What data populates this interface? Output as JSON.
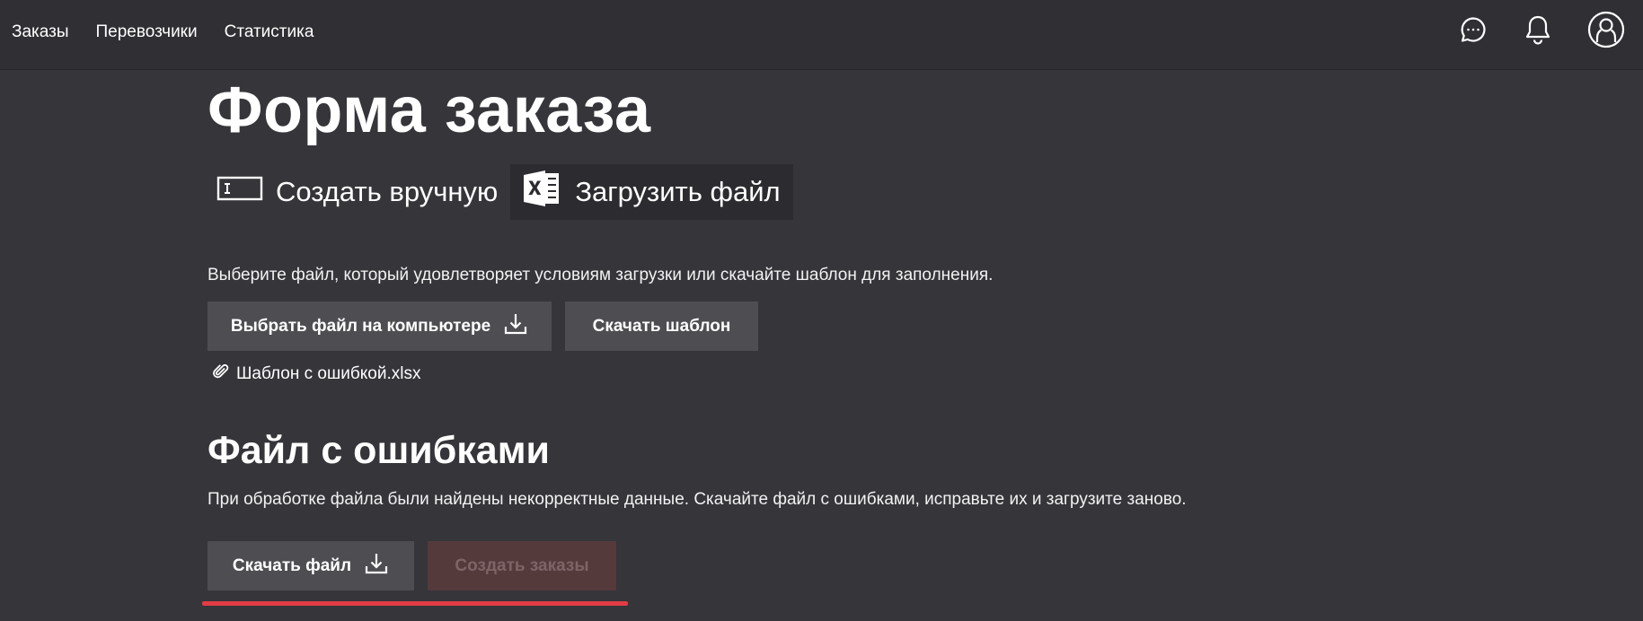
{
  "nav": {
    "items": [
      "Заказы",
      "Перевозчики",
      "Статистика"
    ]
  },
  "header_icons": [
    "chat-icon",
    "bell-icon",
    "user-avatar-icon"
  ],
  "page": {
    "title": "Форма заказа"
  },
  "mode_tabs": {
    "manual_label": "Создать вручную",
    "manual_icon": "text-field-icon",
    "upload_label": "Загрузить файл",
    "upload_icon": "excel-icon",
    "active": "upload"
  },
  "upload": {
    "hint": "Выберите файл, который удовлетворяет условиям загрузки или скачайте шаблон для заполнения.",
    "choose_label": "Выбрать файл на компьютере",
    "template_label": "Скачать шаблон",
    "attached_file": "Шаблон с ошибкой.xlsx"
  },
  "errors": {
    "title": "Файл с ошибками",
    "description": "При обработке файла были найдены некорректные данные. Скачайте файл с ошибками, исправьте их и загрузите заново.",
    "download_label": "Скачать файл",
    "create_label": "Создать заказы",
    "create_disabled": true
  },
  "colors": {
    "background": "#35353a",
    "topbar": "#2f2f34",
    "button": "#4d4d52",
    "disabled_button": "#553a3c",
    "accent_red": "#e33b43"
  }
}
